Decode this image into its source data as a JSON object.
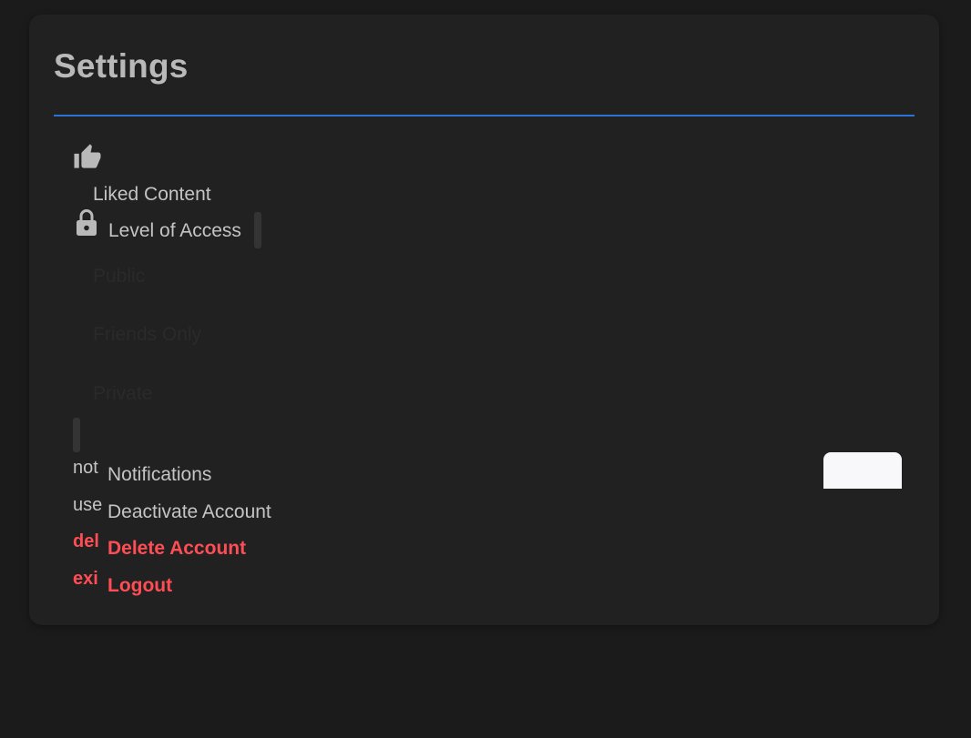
{
  "page": {
    "title": "Settings"
  },
  "liked": {
    "icon": "thumbs-up-icon",
    "label": "Liked Content"
  },
  "access": {
    "icon": "lock-icon",
    "label": "Level of Access",
    "options": [
      "Public",
      "Friends Only",
      "Private"
    ]
  },
  "menu": {
    "items": [
      {
        "prefix": "not",
        "label": "Notifications",
        "style": "normal"
      },
      {
        "prefix": "use",
        "label": "Deactivate Account",
        "style": "normal"
      },
      {
        "prefix": "del",
        "label": "Delete Account",
        "style": "danger"
      },
      {
        "prefix": "exi",
        "label": "Logout",
        "style": "danger"
      }
    ]
  },
  "colors": {
    "accent": "#2a72d6",
    "danger": "#ff4d55",
    "card": "#212121",
    "background": "#1b1b1b"
  }
}
